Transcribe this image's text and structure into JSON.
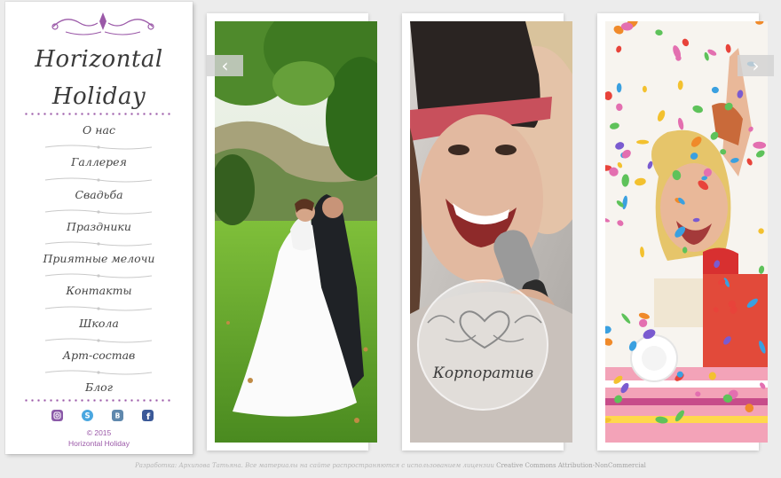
{
  "brand": {
    "line1": "Horizontal",
    "line2": "Holiday"
  },
  "menu": [
    {
      "label": "О нас"
    },
    {
      "label": "Галлерея"
    },
    {
      "label": "Свадьба"
    },
    {
      "label": "Праздники"
    },
    {
      "label": "Приятные мелочи"
    },
    {
      "label": "Контакты"
    },
    {
      "label": "Школа"
    },
    {
      "label": "Арт-состав"
    },
    {
      "label": "Блог"
    }
  ],
  "social": [
    {
      "icon": "instagram-icon",
      "color": "#8b5aa8"
    },
    {
      "icon": "skype-icon",
      "color": "#4aa7e0"
    },
    {
      "icon": "vk-icon",
      "color": "#5f88ad"
    },
    {
      "icon": "facebook-icon",
      "color": "#3b5998"
    }
  ],
  "copyright": {
    "year": "© 2015",
    "name": "Horizontal Holiday"
  },
  "gallery": {
    "prev_arrow": "‹",
    "next_arrow": "›",
    "cards": [
      {
        "caption": ""
      },
      {
        "caption": "Корпоратив"
      },
      {
        "caption": ""
      }
    ]
  },
  "footer": {
    "text": "Разработка: Архипова Татьяна. Все материалы на сайте распространяются с использованием лицензии",
    "license": "Creative Commons Attribution-NonCommercial"
  },
  "colors": {
    "accent": "#9b59a8",
    "background": "#ececec"
  }
}
